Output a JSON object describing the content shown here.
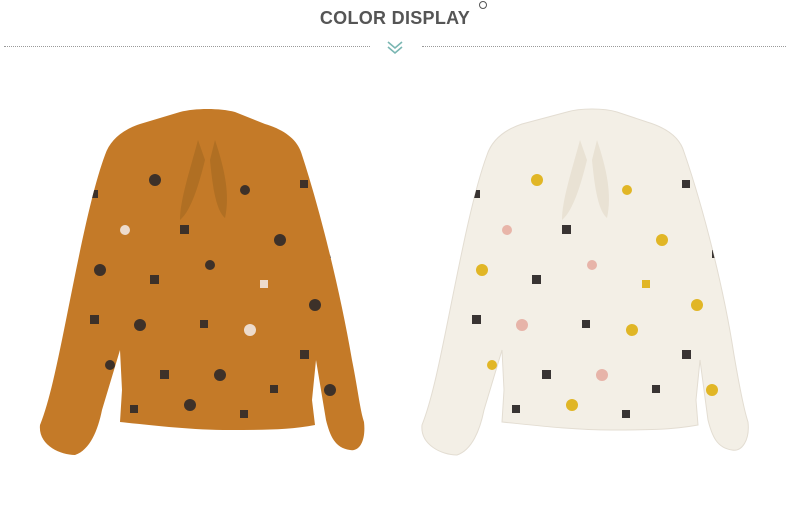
{
  "header": {
    "title": "COLOR DISPLAY",
    "chevron_icon": "double-chevron-down-icon"
  },
  "products": [
    {
      "name": "orange-blouse",
      "color": "#c47a28"
    },
    {
      "name": "white-blouse",
      "color": "#f3efe6"
    }
  ]
}
